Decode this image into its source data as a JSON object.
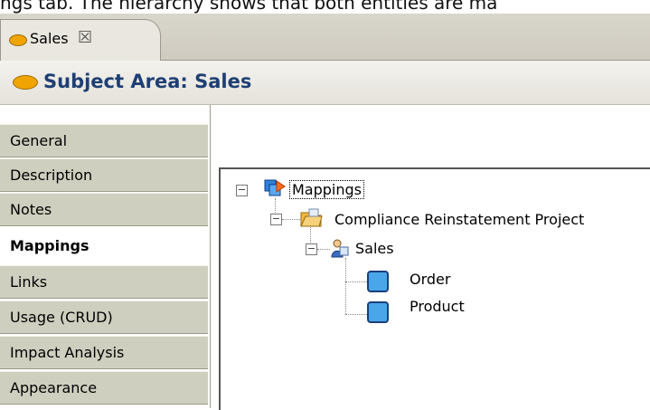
{
  "caption": "ngs tab.  The hierarchy shows that both entities are ma",
  "editor_tab": {
    "label": "Sales",
    "close_glyph": "☒"
  },
  "header": {
    "title": "Subject Area: Sales"
  },
  "colors": {
    "accent_oval": "#f0a400",
    "title_blue": "#1f3f73",
    "entity_fill": "#4aa6e8"
  },
  "sidebar": {
    "items": [
      {
        "label": "General"
      },
      {
        "label": "Description"
      },
      {
        "label": "Notes"
      },
      {
        "label": "Mappings",
        "active": true
      },
      {
        "label": "Links"
      },
      {
        "label": "Usage (CRUD)"
      },
      {
        "label": "Impact Analysis"
      },
      {
        "label": "Appearance"
      }
    ]
  },
  "tree": {
    "root": {
      "label": "Mappings",
      "icon": "mappings-icon",
      "expander": "⊟"
    },
    "project": {
      "label": "Compliance Reinstatement  Project",
      "icon": "folder-icon",
      "expander": "⊟"
    },
    "subject": {
      "label": "Sales",
      "icon": "subject-area-icon",
      "expander": "⊟"
    },
    "entities": [
      {
        "label": "Order",
        "icon": "entity-icon"
      },
      {
        "label": "Product",
        "icon": "entity-icon"
      }
    ]
  }
}
